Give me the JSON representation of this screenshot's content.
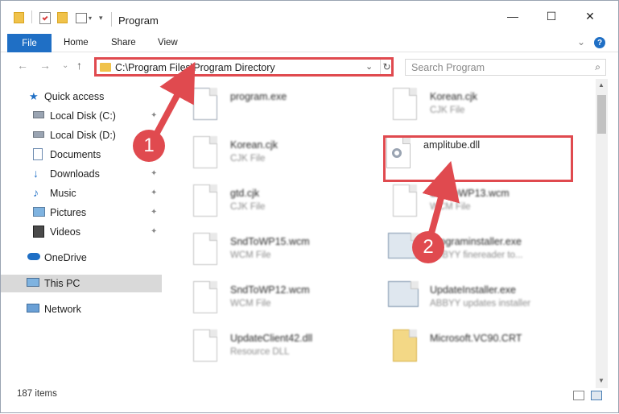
{
  "window": {
    "title": "Program",
    "minimize": "—",
    "maximize": "☐",
    "close": "✕"
  },
  "ribbon": {
    "file": "File",
    "home": "Home",
    "share": "Share",
    "view": "View",
    "collapse": "⌄",
    "help": "?"
  },
  "nav": {
    "back": "←",
    "forward": "→",
    "recent": "⌄",
    "up": "↑",
    "address": "C:\\Program Files\\Program Directory",
    "address_dropdown": "⌄",
    "refresh": "↻",
    "search_placeholder": "Search Program",
    "search_icon": "🔍"
  },
  "sidebar": {
    "items": [
      {
        "label": "Quick access",
        "icon": "star-icon"
      },
      {
        "label": "Local Disk (C:)",
        "icon": "drive-icon"
      },
      {
        "label": "Local Disk (D:)",
        "icon": "drive-icon"
      },
      {
        "label": "Documents",
        "icon": "documents-icon"
      },
      {
        "label": "Downloads",
        "icon": "download-icon"
      },
      {
        "label": "Music",
        "icon": "music-icon"
      },
      {
        "label": "Pictures",
        "icon": "pictures-icon"
      },
      {
        "label": "Videos",
        "icon": "videos-icon"
      },
      {
        "label": "OneDrive",
        "icon": "cloud-icon"
      },
      {
        "label": "This PC",
        "icon": "computer-icon"
      },
      {
        "label": "Network",
        "icon": "network-icon"
      }
    ],
    "pin_glyph": "📌"
  },
  "files": [
    {
      "name": "program.exe",
      "type": ""
    },
    {
      "name": "Korean.cjk",
      "type": "CJK File"
    },
    {
      "name": "Korean.cjk",
      "type": "CJK File"
    },
    {
      "name": "amplitube.dll",
      "type": ""
    },
    {
      "name": "gtd.cjk",
      "type": "CJK File"
    },
    {
      "name": "SndToWP13.wcm",
      "type": "WCM File"
    },
    {
      "name": "SndToWP15.wcm",
      "type": "WCM File"
    },
    {
      "name": "Programinstaller.exe",
      "type": "ABBYY finereader to..."
    },
    {
      "name": "SndToWP12.wcm",
      "type": "WCM File"
    },
    {
      "name": "UpdateInstaller.exe",
      "type": "ABBYY updates installer"
    },
    {
      "name": "UpdateClient42.dll",
      "type": "Resource DLL"
    },
    {
      "name": "Microsoft.VC90.CRT",
      "type": ""
    }
  ],
  "status": {
    "count": "187 items"
  },
  "callouts": {
    "step1": "1",
    "step2": "2"
  },
  "colors": {
    "accent": "#1f6fc5",
    "highlight": "#e04a4f",
    "folder": "#f0c24a"
  }
}
